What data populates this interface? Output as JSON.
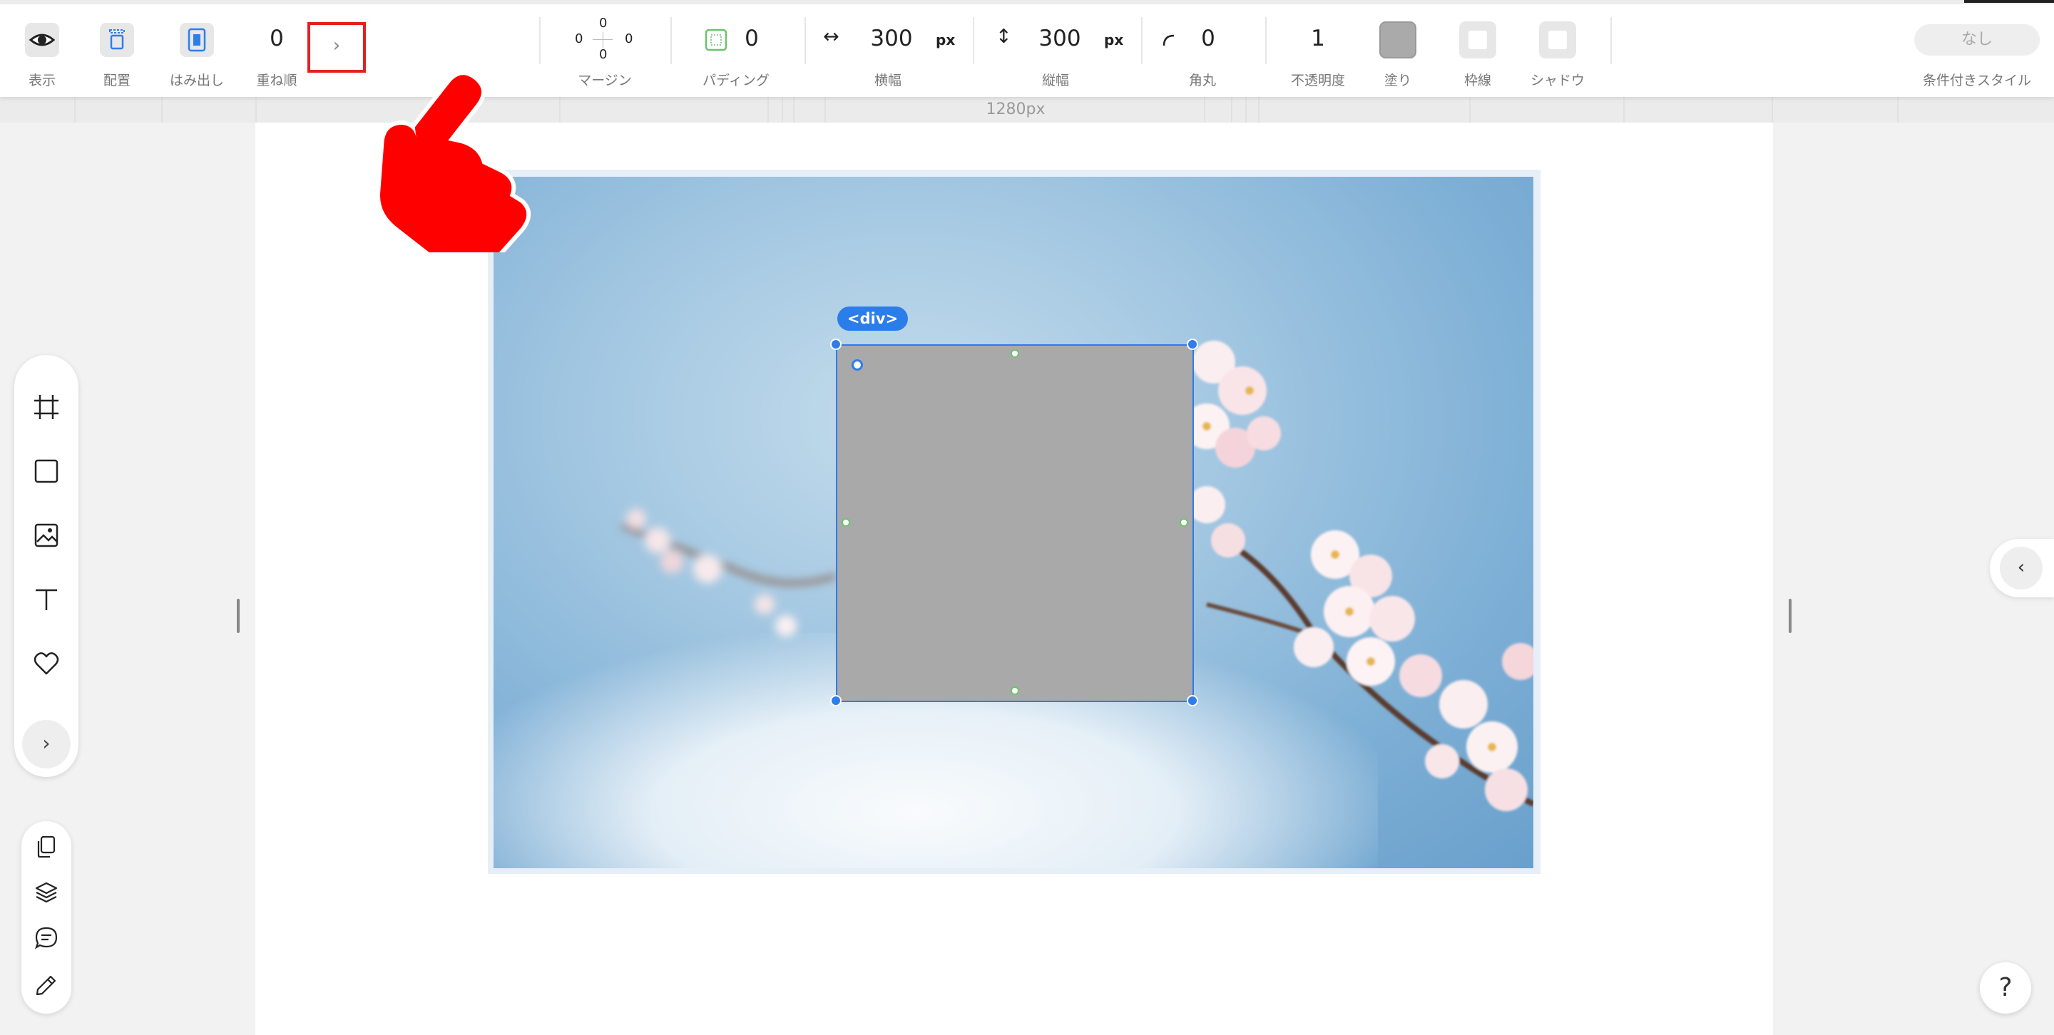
{
  "toolbar": {
    "display_label": "表示",
    "placement_label": "配置",
    "overflow_label": "はみ出し",
    "zorder_label": "重ね順",
    "zorder_value": "0",
    "zorder_next_glyph": "›",
    "margin_label": "マージン",
    "margin": {
      "top": "0",
      "left": "0",
      "right": "0",
      "bottom": "0"
    },
    "padding_label": "パディング",
    "padding_value": "0",
    "width_label": "横幅",
    "width_value": "300",
    "width_unit": "px",
    "height_label": "縦幅",
    "height_value": "300",
    "height_unit": "px",
    "radius_label": "角丸",
    "radius_value": "0",
    "opacity_label": "不透明度",
    "opacity_value": "1",
    "fill_label": "塗り",
    "fill_color": "#aaaaaa",
    "border_label": "枠線",
    "shadow_label": "シャドウ",
    "conditional_style_label": "条件付きスタイル",
    "conditional_style_value": "なし"
  },
  "ruler": {
    "label": "1280px"
  },
  "canvas": {
    "selected_tag": "<div>",
    "selected_fill": "#a9a9a9",
    "accent": "#2f7deb"
  },
  "tools": [
    "frame-icon",
    "rectangle-icon",
    "image-icon",
    "text-icon",
    "heart-icon"
  ],
  "tools_expand_glyph": "›",
  "panels": [
    "copy-icon",
    "layers-icon",
    "comment-icon",
    "pencil-icon"
  ],
  "right_collapse_glyph": "‹",
  "help_glyph": "?"
}
